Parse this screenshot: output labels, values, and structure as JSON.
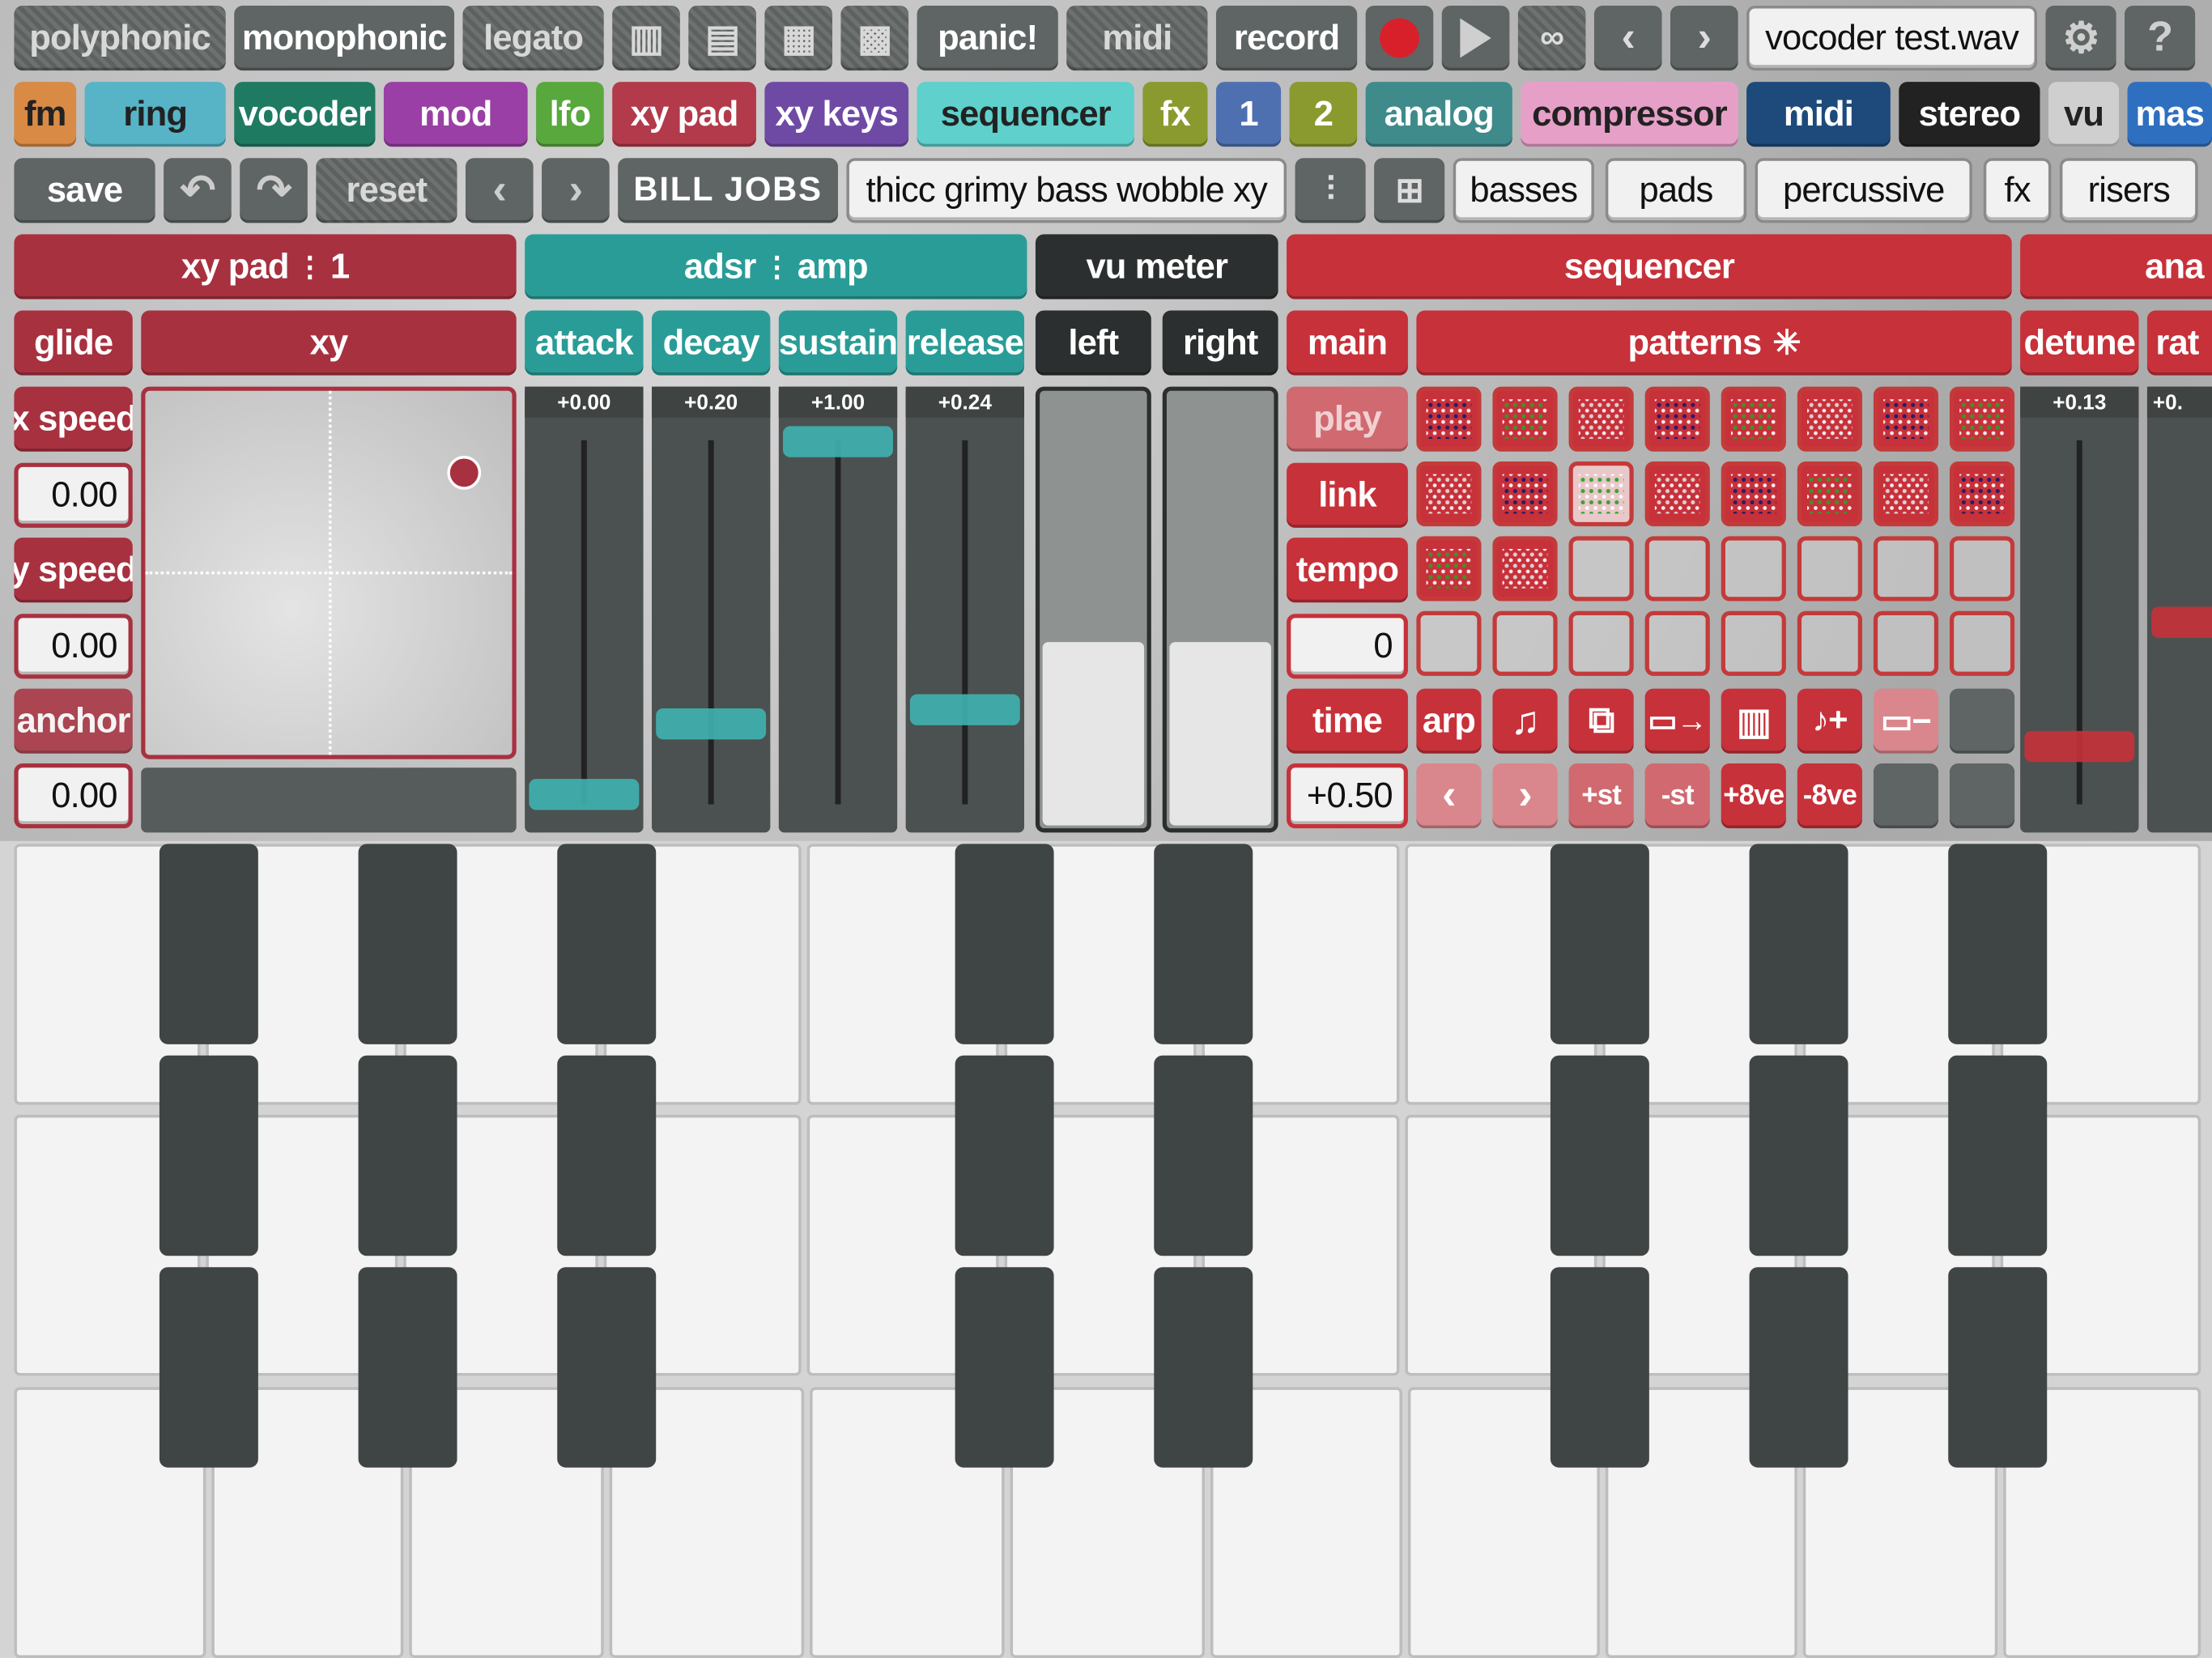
{
  "mode_bar": {
    "polyphonic": "polyphonic",
    "monophonic": "monophonic",
    "legato": "legato",
    "panic": "panic!",
    "midi": "midi",
    "record": "record",
    "filename": "vocoder test.wav"
  },
  "module_tabs": [
    {
      "label": "fm",
      "color": "#d98a45"
    },
    {
      "label": "ring",
      "color": "#57b3c6"
    },
    {
      "label": "vocoder",
      "color": "#1f7a62"
    },
    {
      "label": "mod",
      "color": "#9a3fa5"
    },
    {
      "label": "lfo",
      "color": "#58a83d"
    },
    {
      "label": "xy pad",
      "color": "#b23a4a"
    },
    {
      "label": "xy keys",
      "color": "#6f4aa5"
    },
    {
      "label": "sequencer",
      "color": "#5fd0cc"
    },
    {
      "label": "fx",
      "color": "#8a9a2f"
    },
    {
      "label": "1",
      "color": "#4f70b0"
    },
    {
      "label": "2",
      "color": "#8a9a2f"
    },
    {
      "label": "analog",
      "color": "#3f8a8a"
    },
    {
      "label": "compressor",
      "color": "#e6a0c8"
    },
    {
      "label": "midi",
      "color": "#1d4a7a"
    },
    {
      "label": "stereo",
      "color": "#222222"
    },
    {
      "label": "vu",
      "color": "#cfcfcf"
    },
    {
      "label": "mas",
      "color": "#2f6fc0"
    }
  ],
  "preset_bar": {
    "save": "save",
    "reset": "reset",
    "author": "BILL JOBS",
    "preset_name": "thicc grimy bass wobble xy",
    "categories": [
      "basses",
      "pads",
      "percussive",
      "fx",
      "risers"
    ]
  },
  "xy_module": {
    "title": "xy pad",
    "title_index": "1",
    "glide": "glide",
    "xy": "xy",
    "x_speed_label": "x speed",
    "x_speed_value": "0.00",
    "y_speed_label": "y speed",
    "y_speed_value": "0.00",
    "anchor_label": "anchor",
    "anchor_value": "0.00"
  },
  "adsr_module": {
    "title": "adsr",
    "title_sub": "amp",
    "sliders": [
      {
        "label": "attack",
        "value": "+0.00",
        "level": 0.0
      },
      {
        "label": "decay",
        "value": "+0.20",
        "level": 0.2
      },
      {
        "label": "sustain",
        "value": "+1.00",
        "level": 1.0
      },
      {
        "label": "release",
        "value": "+0.24",
        "level": 0.24
      }
    ]
  },
  "vu_module": {
    "title": "vu meter",
    "left": "left",
    "right": "right"
  },
  "sequencer_module": {
    "title": "sequencer",
    "main": "main",
    "patterns": "patterns",
    "play": "play",
    "link": "link",
    "tempo": "tempo",
    "tempo_value": "0",
    "time": "time",
    "time_value": "+0.50",
    "arp": "arp",
    "plus_st": "+st",
    "minus_st": "-st",
    "plus_8ve": "+8ve",
    "minus_8ve": "-8ve"
  },
  "analog_module": {
    "title": "ana",
    "detune": "detune",
    "detune_value": "+0.13",
    "rate": "rat",
    "rate_value": "+0."
  }
}
